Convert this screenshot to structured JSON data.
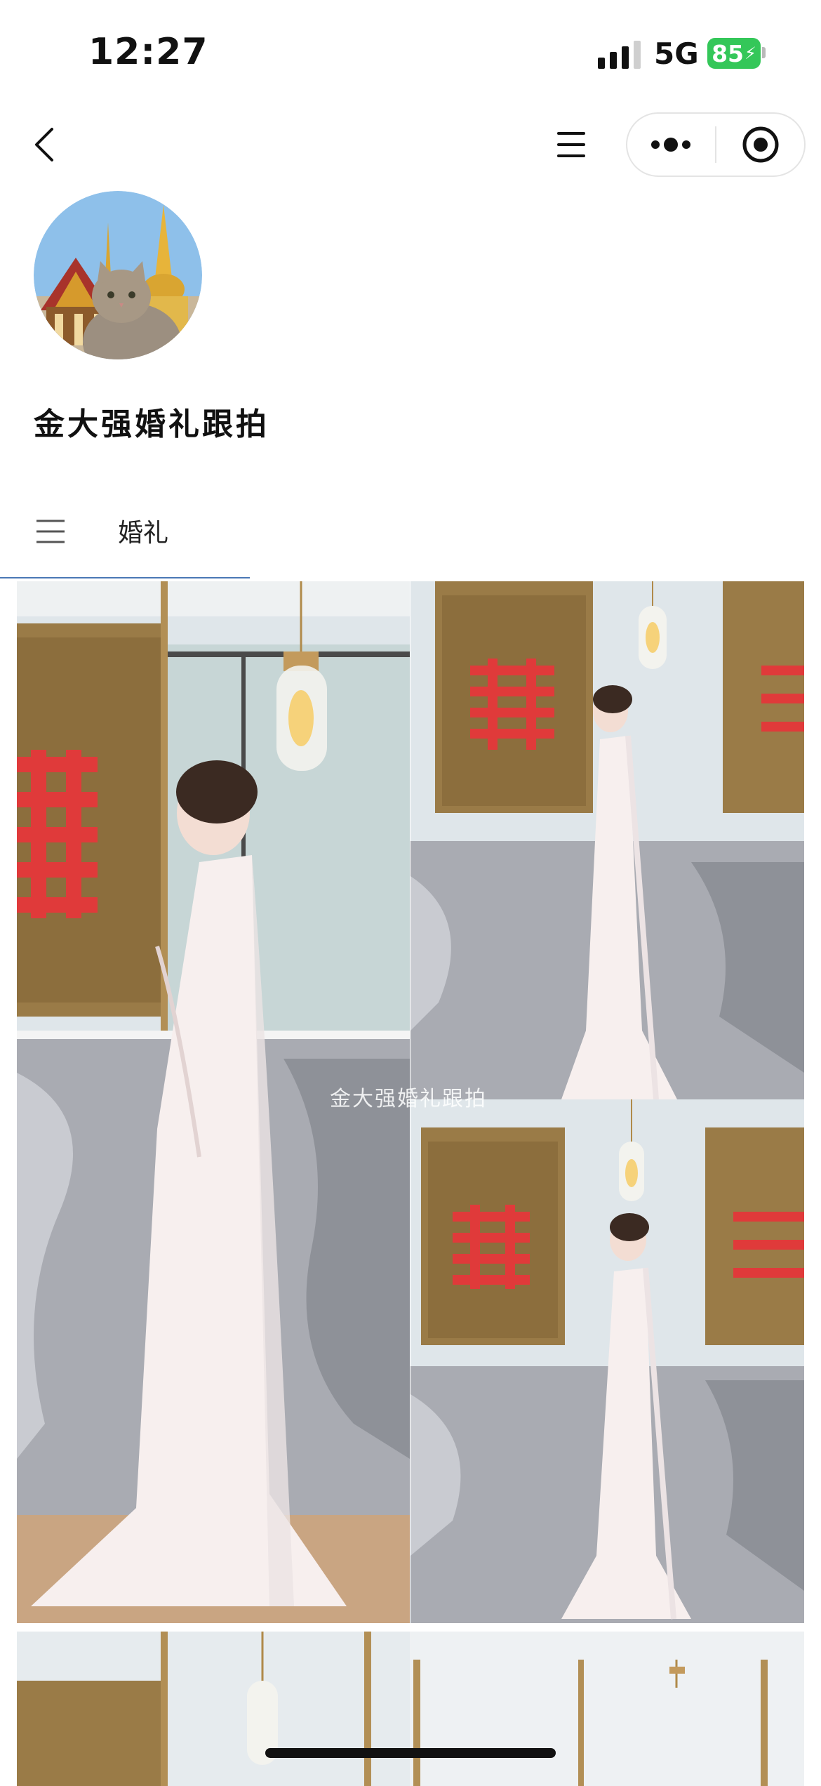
{
  "status_bar": {
    "time": "12:27",
    "network": "5G",
    "battery": "85",
    "icons": [
      "signal-icon",
      "battery-charging-icon"
    ]
  },
  "nav": {
    "icons": [
      "back-arrow-icon",
      "menu-icon",
      "more-dots-icon",
      "target-icon"
    ]
  },
  "profile": {
    "name": "金大强婚礼跟拍",
    "avatar": "avatar-cat-temple-photo"
  },
  "tabs": [
    {
      "label": "婚礼",
      "active": true
    }
  ],
  "gallery": {
    "watermark": "金大强婚礼跟拍",
    "photos": [
      "wedding-dress-photo-full",
      "wedding-dress-photo-small-1",
      "wedding-dress-photo-small-2",
      "wedding-photo-next-row"
    ]
  },
  "colors": {
    "battery": "#34c759",
    "tab_underline": "#4a78b5",
    "double_happiness": "#e03a3a"
  }
}
